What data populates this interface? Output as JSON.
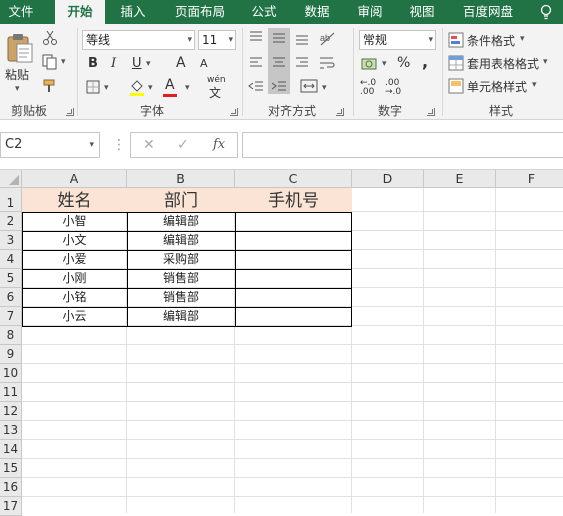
{
  "tabs": [
    "文件",
    "开始",
    "插入",
    "页面布局",
    "公式",
    "数据",
    "审阅",
    "视图",
    "百度网盘"
  ],
  "active_tab": "开始",
  "ribbon": {
    "clipboard": {
      "paste_label": "粘贴",
      "group_label": "剪贴板"
    },
    "font": {
      "font_name": "等线",
      "font_size": "11",
      "group_label": "字体",
      "bold": "B",
      "italic": "I",
      "underline": "U",
      "grow": "A",
      "shrink": "A",
      "phonetic": "wén",
      "font_color_letter": "A"
    },
    "alignment": {
      "group_label": "对齐方式"
    },
    "number": {
      "format": "常规",
      "percent": "%",
      "comma": ",",
      "inc_decimal": "←.0 .00",
      "dec_decimal": ".00 →.0",
      "group_label": "数字"
    },
    "styles": {
      "conditional": "条件格式",
      "table_format": "套用表格格式",
      "cell_styles": "单元格样式",
      "group_label": "样式"
    }
  },
  "formula_bar": {
    "name_box": "C2",
    "cancel": "✕",
    "enter": "✓",
    "fx": "fx",
    "value": ""
  },
  "colors": {
    "accent": "#217346",
    "header_fill": "#fbe4d5"
  },
  "grid": {
    "columns": [
      "A",
      "B",
      "C",
      "D",
      "E",
      "F"
    ],
    "rows": [
      "1",
      "2",
      "3",
      "4",
      "5",
      "6",
      "7",
      "8",
      "9",
      "10",
      "11",
      "12",
      "13",
      "14",
      "15",
      "16",
      "17"
    ],
    "table_headers": [
      "姓名",
      "部门",
      "手机号"
    ],
    "table_rows": [
      [
        "小智",
        "编辑部",
        ""
      ],
      [
        "小文",
        "编辑部",
        ""
      ],
      [
        "小爱",
        "采购部",
        ""
      ],
      [
        "小刚",
        "销售部",
        ""
      ],
      [
        "小铭",
        "销售部",
        ""
      ],
      [
        "小云",
        "编辑部",
        ""
      ]
    ]
  }
}
